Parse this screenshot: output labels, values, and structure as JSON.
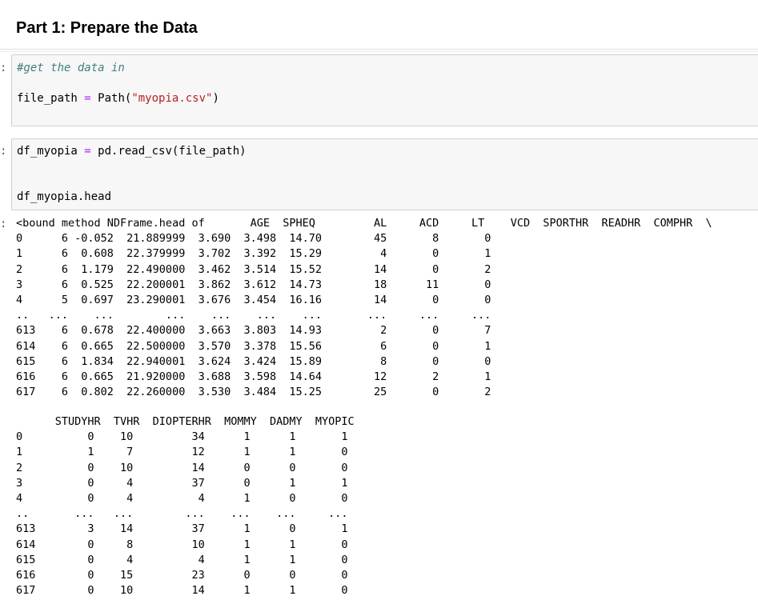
{
  "heading": "Part 1: Prepare the Data",
  "prompt_char": ":",
  "cells": [
    {
      "line1_comment": "#get the data in",
      "line2_var": "file_path ",
      "line2_op": "=",
      "line2_call": " Path(",
      "line2_str": "\"myopia.csv\"",
      "line2_end": ")"
    },
    {
      "line1_var": "df_myopia ",
      "line1_op": "=",
      "line1_rest": " pd.read_csv(file_path)",
      "line2": "df_myopia.head"
    }
  ],
  "output": {
    "block1_header": "<bound method NDFrame.head of       AGE  SPHEQ         AL     ACD     LT    VCD  SPORTHR  READHR  COMPHR  \\",
    "block1_rows": [
      "0      6 -0.052  21.889999  3.690  3.498  14.70        45       8       0",
      "1      6  0.608  22.379999  3.702  3.392  15.29         4       0       1",
      "2      6  1.179  22.490000  3.462  3.514  15.52        14       0       2",
      "3      6  0.525  22.200001  3.862  3.612  14.73        18      11       0",
      "4      5  0.697  23.290001  3.676  3.454  16.16        14       0       0",
      "..   ...    ...        ...    ...    ...    ...       ...     ...     ...",
      "613    6  0.678  22.400000  3.663  3.803  14.93         2       0       7",
      "614    6  0.665  22.500000  3.570  3.378  15.56         6       0       1",
      "615    6  1.834  22.940001  3.624  3.424  15.89         8       0       0",
      "616    6  0.665  21.920000  3.688  3.598  14.64        12       2       1",
      "617    6  0.802  22.260000  3.530  3.484  15.25        25       0       2"
    ],
    "block2_header": "      STUDYHR  TVHR  DIOPTERHR  MOMMY  DADMY  MYOPIC",
    "block2_rows": [
      "0          0    10         34      1      1       1",
      "1          1     7         12      1      1       0",
      "2          0    10         14      0      0       0",
      "3          0     4         37      0      1       1",
      "4          0     4          4      1      0       0",
      "..       ...   ...        ...    ...    ...     ...",
      "613        3    14         37      1      0       1",
      "614        0     8         10      1      1       0",
      "615        0     4          4      1      1       0",
      "616        0    15         23      0      0       0",
      "617        0    10         14      1      1       0"
    ]
  }
}
